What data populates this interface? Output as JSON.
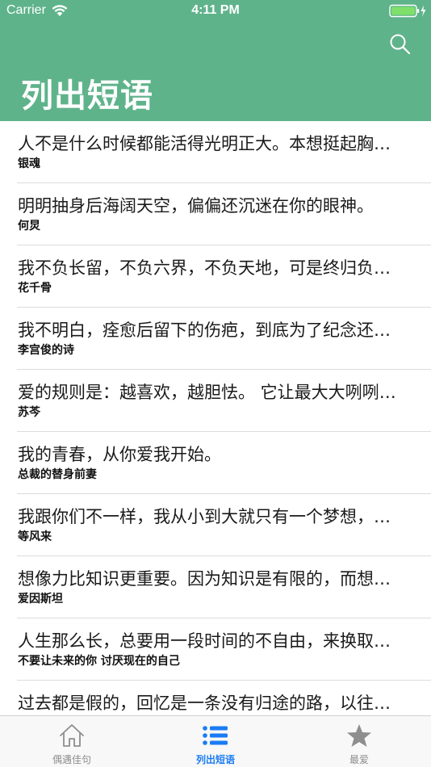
{
  "status_bar": {
    "carrier": "Carrier",
    "time": "4:11 PM"
  },
  "header": {
    "title": "列出短语",
    "search_icon": "search-icon",
    "background_color": "#5fb38b"
  },
  "items": [
    {
      "text": "人不是什么时候都能活得光明正大。本想挺起胸膛做人，结果腰却弯了",
      "source": "银魂"
    },
    {
      "text": "明明抽身后海阔天空，偏偏还沉迷在你的眼神。",
      "source": "何炅"
    },
    {
      "text": "我不负长留，不负六界，不负天地，可是终归负了你",
      "source": "花千骨"
    },
    {
      "text": "我不明白，痊愈后留下的伤疤，到底为了纪念还是为了忘记",
      "source": "李宫俊的诗"
    },
    {
      "text": "爱的规则是：越喜欢，越胆怯。 它让最大大咧咧的人变得小心翼翼",
      "source": "苏芩"
    },
    {
      "text": "我的青春，从你爱我开始。",
      "source": "总裁的替身前妻"
    },
    {
      "text": "我跟你们不一样，我从小到大就只有一个梦想，就是嫁给你",
      "source": "等风来"
    },
    {
      "text": "想像力比知识更重要。因为知识是有限的，而想像力概括着世界的一切",
      "source": "爱因斯坦"
    },
    {
      "text": "人生那么长，总要用一段时间的不自由，来换取一辈子的自由",
      "source": "不要让未来的你 讨厌现在的自己"
    },
    {
      "text": "过去都是假的，回忆是一条没有归途的路，以往的一切春天都无法复原",
      "source": ""
    }
  ],
  "tabs": [
    {
      "label": "偶遇佳句",
      "icon": "home-icon",
      "active": false
    },
    {
      "label": "列出短语",
      "icon": "list-icon",
      "active": true
    },
    {
      "label": "最爱",
      "icon": "star-icon",
      "active": false
    }
  ],
  "colors": {
    "accent": "#1a7cf3",
    "inactive": "#8e8e8e",
    "battery": "#7ee06b"
  }
}
